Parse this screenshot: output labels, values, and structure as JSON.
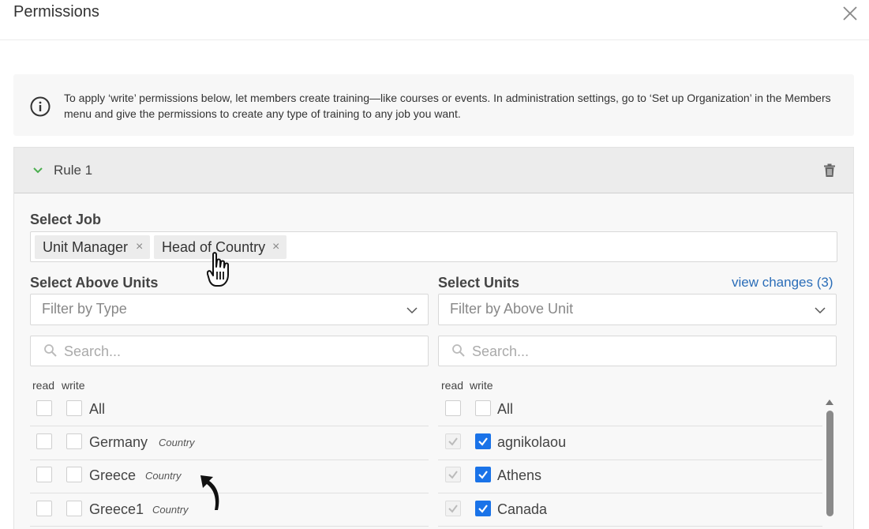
{
  "dialog": {
    "title": "Permissions",
    "close_icon": "close-icon"
  },
  "info": {
    "icon": "info-icon",
    "text": "To apply ‘write’ permissions below, let members create training—like courses or events. In administration settings, go to ‘Set up Organization’ in the Members menu and give the permissions to create any type of training to any job you want."
  },
  "rule": {
    "title": "Rule 1",
    "chevron_icon": "chevron-down-icon",
    "delete_icon": "trash-icon"
  },
  "select_job": {
    "label": "Select Job",
    "tags": [
      {
        "label": "Unit Manager"
      },
      {
        "label": "Head of Country"
      }
    ]
  },
  "above_units": {
    "label": "Select Above Units",
    "filter_placeholder": "Filter by Type",
    "search_placeholder": "Search...",
    "col_read": "read",
    "col_write": "write",
    "all_label": "All",
    "rows": [
      {
        "name": "Germany",
        "type": "Country"
      },
      {
        "name": "Greece",
        "type": "Country"
      },
      {
        "name": "Greece1",
        "type": "Country"
      }
    ]
  },
  "units": {
    "label": "Select Units",
    "view_changes": "view changes (3)",
    "filter_placeholder": "Filter by Above Unit",
    "search_placeholder": "Search...",
    "col_read": "read",
    "col_write": "write",
    "all_label": "All",
    "rows": [
      {
        "name": "agnikolaou",
        "read": true,
        "write": true
      },
      {
        "name": "Athens",
        "read": true,
        "write": true
      },
      {
        "name": "Canada",
        "read": true,
        "write": true
      }
    ]
  },
  "colors": {
    "accent": "#1a73e8",
    "link": "#2a6db8",
    "chevron": "#4caf50"
  }
}
